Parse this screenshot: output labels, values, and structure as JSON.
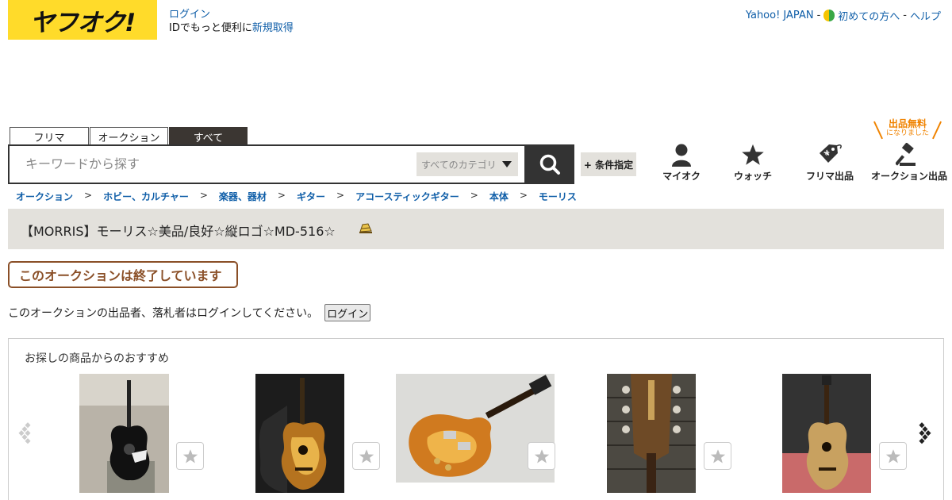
{
  "header": {
    "logo_text": "ヤフオク!",
    "login_link": "ログイン",
    "signup_prefix": "IDでもっと便利に",
    "signup_link": "新規取得",
    "links": [
      "Yahoo! JAPAN",
      "初めての方へ",
      "ヘルプ"
    ],
    "separator": "-"
  },
  "search": {
    "tabs": [
      "フリマ",
      "オークション",
      "すべて"
    ],
    "active_tab": "すべて",
    "placeholder": "キーワードから探す",
    "category": "すべてのカテゴリ",
    "condition_button": "+ 条件指定"
  },
  "nav_icons": {
    "my_auction": "マイオク",
    "watch": "ウォッチ",
    "flea_sell": "フリマ出品",
    "auction_sell": "オークション出品",
    "free_badge_main": "出品無料",
    "free_badge_sub": "になりました"
  },
  "breadcrumb": [
    "オークション",
    "ホビー、カルチャー",
    "楽器、器材",
    "ギター",
    "アコースティックギター",
    "本体",
    "モーリス"
  ],
  "breadcrumb_sep": ">",
  "item": {
    "title": "【MORRIS】モーリス☆美品/良好☆縦ロゴ☆MD-516☆",
    "ended_notice": "このオークションは終了しています",
    "login_message": "このオークションの出品者、落札者はログインしてください。",
    "login_button": "ログイン"
  },
  "recommend": {
    "title": "お探しの商品からのおすすめ",
    "items": [
      {
        "image": "black-acoustic-guitar"
      },
      {
        "image": "sunburst-acoustic-guitar-with-case"
      },
      {
        "image": "les-paul-electric-guitar"
      },
      {
        "image": "guitar-headstock-closeup"
      },
      {
        "image": "natural-acoustic-guitar"
      }
    ]
  },
  "colors": {
    "brand_yellow": "#ffdb2a",
    "link_blue": "#0f5ea8",
    "ended_brown": "#8a4f27",
    "free_orange": "#f08300",
    "title_bar": "#e3e1dc"
  }
}
